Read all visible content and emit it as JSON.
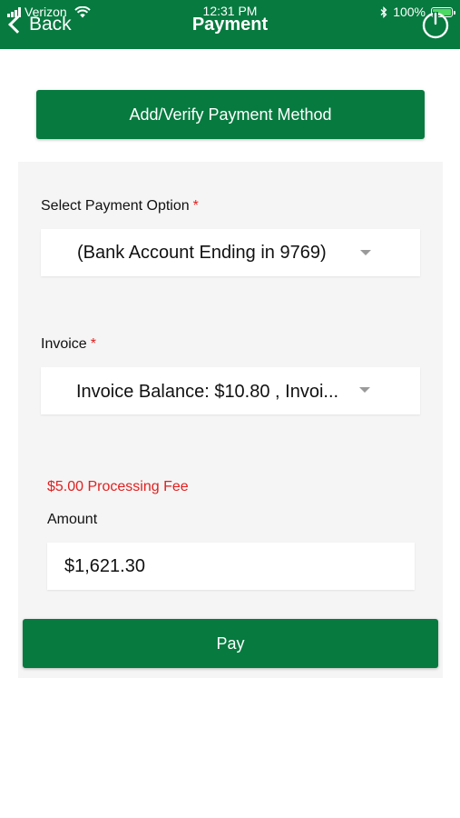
{
  "status_bar": {
    "carrier": "Verizon",
    "time": "12:31 PM",
    "battery": "100%",
    "battery_level": 1.0
  },
  "header": {
    "back_label": "Back",
    "title": "Payment",
    "power_icon": "power-icon"
  },
  "add_method": {
    "label": "Add/Verify Payment Method"
  },
  "form": {
    "payment_option": {
      "label": "Select Payment Option",
      "required_mark": "*",
      "value": "(Bank Account Ending in 9769)"
    },
    "invoice": {
      "label": "Invoice",
      "required_mark": "*",
      "value": "Invoice Balance: $10.80 , Invoi..."
    },
    "processing_fee": "$5.00 Processing Fee",
    "amount": {
      "label": "Amount",
      "value": "$1,621.30"
    },
    "pay_label": "Pay"
  },
  "colors": {
    "brand_green": "#067a3f",
    "required_red": "#e02020",
    "panel_bg": "#f5f5f5"
  }
}
